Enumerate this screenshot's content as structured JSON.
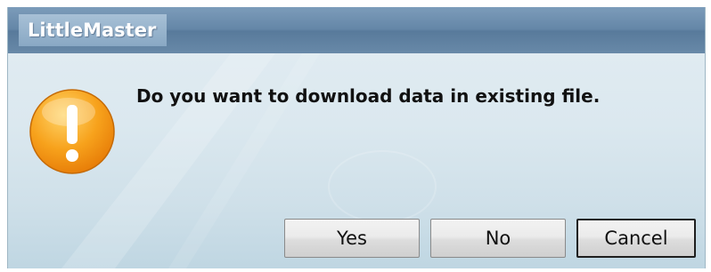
{
  "window": {
    "title": "LittleMaster"
  },
  "dialog": {
    "message": "Do you want to download data in existing file.",
    "icon": "warning-exclamation-icon"
  },
  "buttons": {
    "yes": "Yes",
    "no": "No",
    "cancel": "Cancel"
  },
  "colors": {
    "titlebar": "#6486a7",
    "dialog_background": "#dbe8ef",
    "icon_orange": "#f39a1a"
  }
}
